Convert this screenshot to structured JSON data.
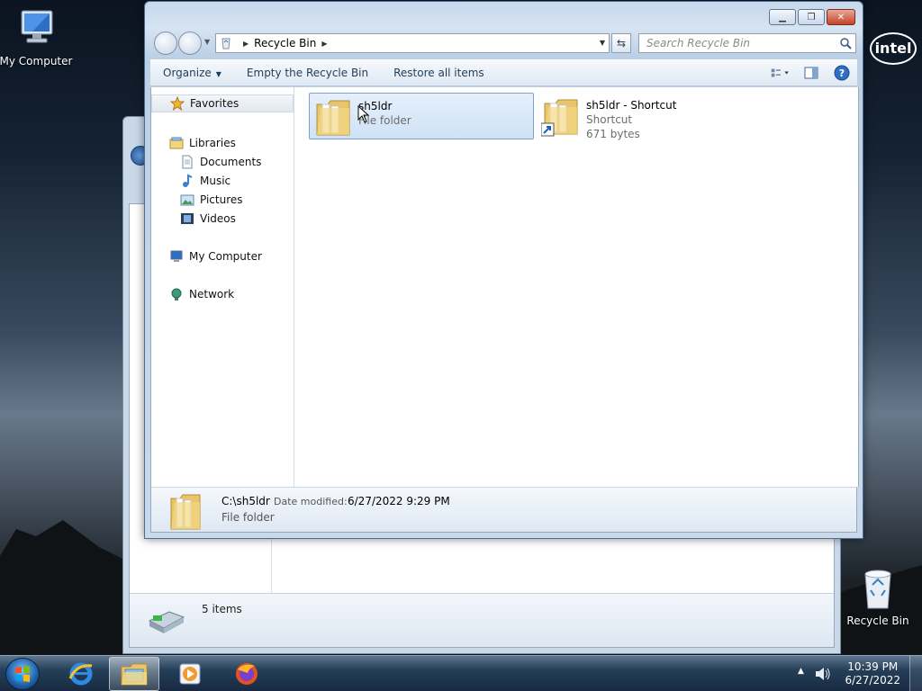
{
  "desktop": {
    "icons": [
      {
        "label": "My Computer",
        "icon": "computer-icon"
      },
      {
        "label": "Recycle Bin",
        "icon": "recycle-bin-icon"
      }
    ],
    "logo": "intel"
  },
  "background_window": {
    "status_count": "5 items"
  },
  "window": {
    "address": {
      "location": "Recycle Bin"
    },
    "search": {
      "placeholder": "Search Recycle Bin"
    },
    "toolbar": {
      "organize": "Organize",
      "empty": "Empty the Recycle Bin",
      "restore": "Restore all items"
    },
    "nav": {
      "favorites": "Favorites",
      "libraries": "Libraries",
      "documents": "Documents",
      "music": "Music",
      "pictures": "Pictures",
      "videos": "Videos",
      "computer": "My Computer",
      "network": "Network"
    },
    "items": [
      {
        "name": "sh5ldr",
        "type": "File folder",
        "size": "",
        "selected": true
      },
      {
        "name": "sh5ldr - Shortcut",
        "type": "Shortcut",
        "size": "671 bytes",
        "selected": false
      }
    ],
    "details": {
      "name": "C:\\sh5ldr",
      "date_label": "Date modified:",
      "date_value": "6/27/2022 9:29 PM",
      "type": "File folder"
    }
  },
  "taskbar": {
    "time": "10:39 PM",
    "date": "6/27/2022",
    "pinned": [
      "internet-explorer-icon",
      "windows-explorer-icon",
      "media-player-icon",
      "firefox-icon"
    ]
  },
  "colors": {
    "selection": "#cfe2f7",
    "toolbar_text": "#1e3d5c",
    "close_button": "#c4422a"
  }
}
